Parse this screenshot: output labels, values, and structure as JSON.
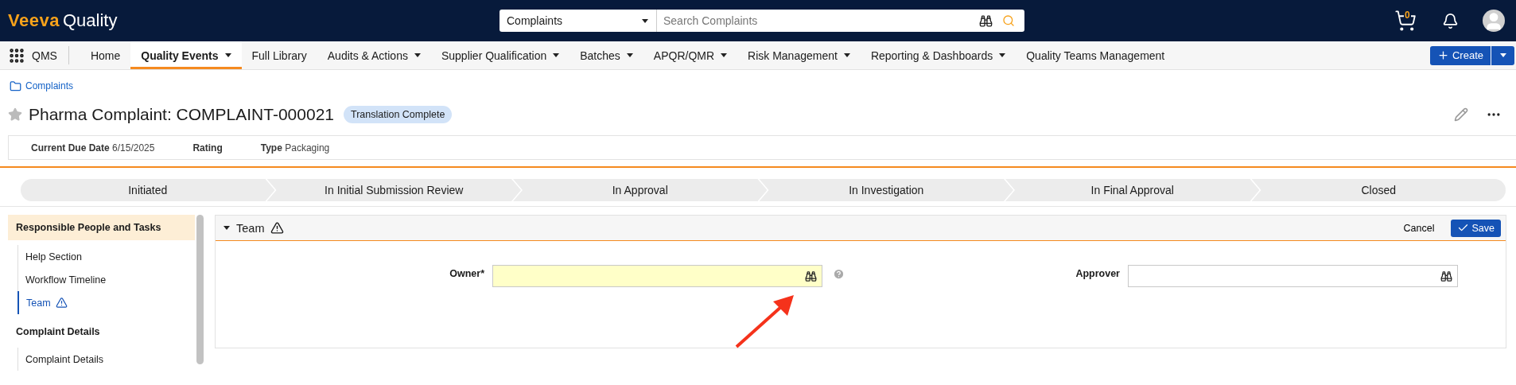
{
  "topbar": {
    "logo": {
      "brand": "Veeva",
      "product": "Quality"
    },
    "search": {
      "scope": "Complaints",
      "placeholder": "Search Complaints"
    },
    "cart_count": "0"
  },
  "nav": {
    "app": "QMS",
    "items": [
      {
        "label": "Home",
        "selected": false,
        "menu": false
      },
      {
        "label": "Quality Events",
        "selected": true,
        "menu": true
      },
      {
        "label": "Full Library",
        "selected": false,
        "menu": false
      },
      {
        "label": "Audits & Actions",
        "selected": false,
        "menu": true
      },
      {
        "label": "Supplier Qualification",
        "selected": false,
        "menu": true
      },
      {
        "label": "Batches",
        "selected": false,
        "menu": true
      },
      {
        "label": "APQR/QMR",
        "selected": false,
        "menu": true
      },
      {
        "label": "Risk Management",
        "selected": false,
        "menu": true
      },
      {
        "label": "Reporting & Dashboards",
        "selected": false,
        "menu": true
      },
      {
        "label": "Quality Teams Management",
        "selected": false,
        "menu": false
      }
    ],
    "create": "Create"
  },
  "breadcrumb": "Complaints",
  "record": {
    "title": "Pharma Complaint: COMPLAINT-000021",
    "favorite": false,
    "badge": "Translation Complete",
    "fields": [
      {
        "label": "Current Due Date",
        "value": "6/15/2025"
      },
      {
        "label": "Rating"
      },
      {
        "label": "Type",
        "value": "Packaging"
      }
    ]
  },
  "stages": [
    "Initiated",
    "In Initial Submission Review",
    "In Approval",
    "In Investigation",
    "In Final Approval",
    "Closed"
  ],
  "sidebar": {
    "sections": [
      {
        "title": "Responsible People and Tasks",
        "selected": true,
        "items": [
          {
            "label": "Help Section",
            "selected": false,
            "warning": false
          },
          {
            "label": "Workflow Timeline",
            "selected": false,
            "warning": false
          },
          {
            "label": "Team",
            "selected": true,
            "warning": true
          }
        ]
      },
      {
        "title": "Complaint Details",
        "selected": false,
        "items": [
          {
            "label": "Complaint Details",
            "selected": false,
            "warning": false
          }
        ]
      }
    ]
  },
  "panel": {
    "title": "Team",
    "expanded": true,
    "warning": true,
    "cancel": "Cancel",
    "save": "Save",
    "fields": [
      {
        "label": "Owner*",
        "required": true,
        "help": true
      },
      {
        "label": "Approver",
        "required": false,
        "help": false
      }
    ]
  }
}
